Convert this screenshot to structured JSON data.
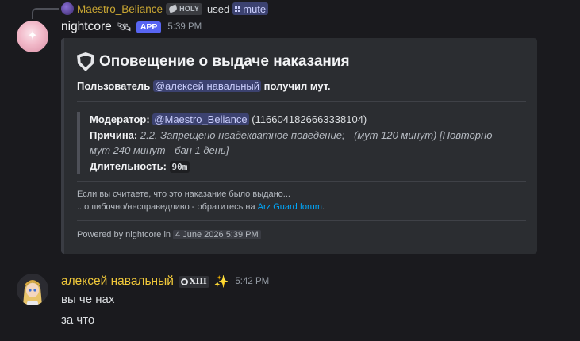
{
  "reply": {
    "username": "Maestro_Beliance",
    "badge": "HOLY",
    "used_text": "used",
    "command": "mute"
  },
  "bot_message": {
    "author": "nightcore",
    "app_tag": "APP",
    "timestamp": "5:39 PM",
    "embed": {
      "title": "Оповещение о выдаче наказания",
      "desc_prefix": "Пользователь",
      "desc_mention": "@алексей навальный",
      "desc_suffix": "получил мут.",
      "moderator_label": "Модератор:",
      "moderator_mention": "@Maestro_Beliance",
      "moderator_id": "(1166041826663338104)",
      "reason_label": "Причина:",
      "reason_text_1": "2.2. Запрещено неадекватное поведение; - (мут 120 минут) [Повторно -",
      "reason_text_2": "мут 240 минут - бан 1 день]",
      "duration_label": "Длительность:",
      "duration_value": "90m",
      "footer_line1": "Если вы считаете, что это наказание было выдано...",
      "footer_line2_prefix": "...ошибочно/несправедливо - обратитесь на",
      "footer_link": "Arz Guard forum",
      "footer_line2_suffix": ".",
      "powered_by": "Powered by nightcore in",
      "powered_ts": "4 June 2026 5:39 PM"
    }
  },
  "user_message": {
    "author": "алексей навальный",
    "badge": "XIII",
    "timestamp": "5:42 PM",
    "lines": [
      "вы че нах",
      "за что"
    ]
  },
  "colors": {
    "background": "#1a1a1e",
    "embed_bg": "#2b2d31",
    "mention_bg": "#3c4270",
    "app_tag": "#5865f2",
    "username_gold": "#f0c83a",
    "link": "#00a8fc"
  },
  "icons": [
    "reply-avatar-icon",
    "holy-leaf-icon",
    "command-grid-icon",
    "bot-decoration-icon",
    "shield-icon",
    "xiii-gear-icon",
    "sparkle-icon"
  ]
}
